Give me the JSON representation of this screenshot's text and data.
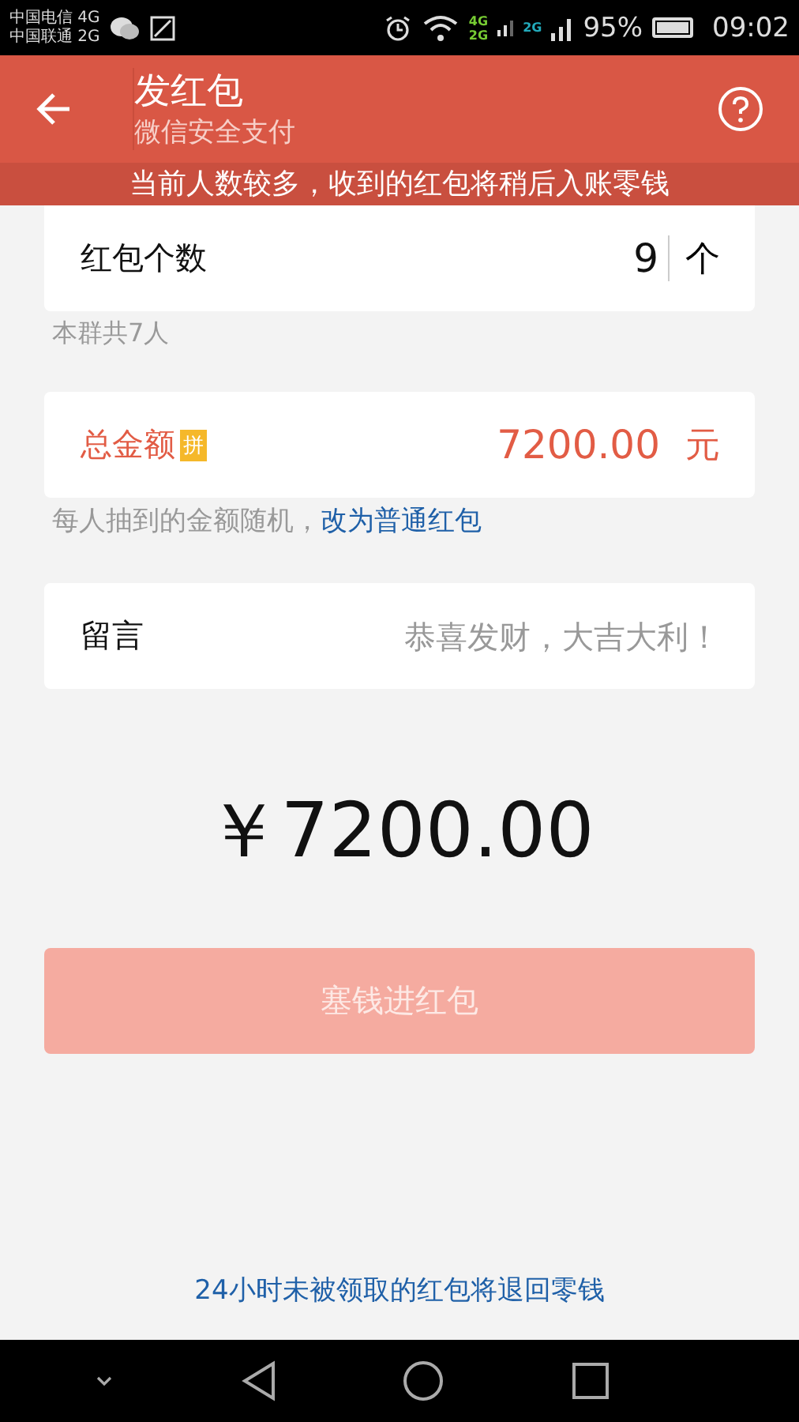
{
  "status_bar": {
    "carriers": [
      "中国电信 4G",
      "中国联通 2G"
    ],
    "signal_labels": [
      "4G",
      "2G",
      "2G"
    ],
    "battery": "95%",
    "time": "09:02"
  },
  "header": {
    "title": "发红包",
    "subtitle": "微信安全支付"
  },
  "notice": "当前人数较多，收到的红包将稍后入账零钱",
  "count": {
    "label": "红包个数",
    "value": "9",
    "unit": "个",
    "hint": "本群共7人"
  },
  "amount": {
    "label": "总金额",
    "badge": "拼",
    "value": "7200.00",
    "unit": "元",
    "hint": "每人抽到的金额随机，",
    "link": "改为普通红包"
  },
  "message": {
    "label": "留言",
    "placeholder": "恭喜发财，大吉大利！"
  },
  "total": "￥7200.00",
  "submit": {
    "label": "塞钱进红包",
    "disabled": true
  },
  "footer_note": "24小时未被领取的红包将退回零钱"
}
